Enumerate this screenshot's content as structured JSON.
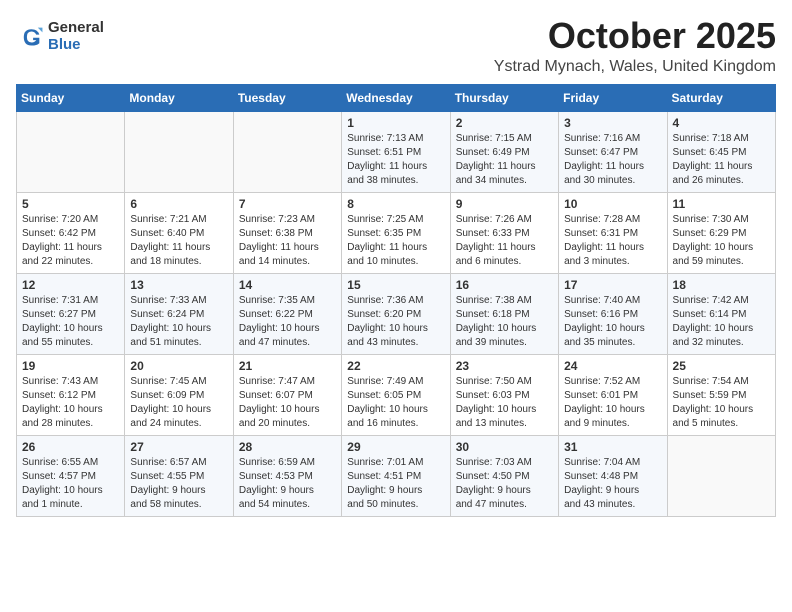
{
  "logo": {
    "general": "General",
    "blue": "Blue"
  },
  "title": "October 2025",
  "subtitle": "Ystrad Mynach, Wales, United Kingdom",
  "headers": [
    "Sunday",
    "Monday",
    "Tuesday",
    "Wednesday",
    "Thursday",
    "Friday",
    "Saturday"
  ],
  "weeks": [
    [
      {
        "day": "",
        "info": ""
      },
      {
        "day": "",
        "info": ""
      },
      {
        "day": "",
        "info": ""
      },
      {
        "day": "1",
        "info": "Sunrise: 7:13 AM\nSunset: 6:51 PM\nDaylight: 11 hours\nand 38 minutes."
      },
      {
        "day": "2",
        "info": "Sunrise: 7:15 AM\nSunset: 6:49 PM\nDaylight: 11 hours\nand 34 minutes."
      },
      {
        "day": "3",
        "info": "Sunrise: 7:16 AM\nSunset: 6:47 PM\nDaylight: 11 hours\nand 30 minutes."
      },
      {
        "day": "4",
        "info": "Sunrise: 7:18 AM\nSunset: 6:45 PM\nDaylight: 11 hours\nand 26 minutes."
      }
    ],
    [
      {
        "day": "5",
        "info": "Sunrise: 7:20 AM\nSunset: 6:42 PM\nDaylight: 11 hours\nand 22 minutes."
      },
      {
        "day": "6",
        "info": "Sunrise: 7:21 AM\nSunset: 6:40 PM\nDaylight: 11 hours\nand 18 minutes."
      },
      {
        "day": "7",
        "info": "Sunrise: 7:23 AM\nSunset: 6:38 PM\nDaylight: 11 hours\nand 14 minutes."
      },
      {
        "day": "8",
        "info": "Sunrise: 7:25 AM\nSunset: 6:35 PM\nDaylight: 11 hours\nand 10 minutes."
      },
      {
        "day": "9",
        "info": "Sunrise: 7:26 AM\nSunset: 6:33 PM\nDaylight: 11 hours\nand 6 minutes."
      },
      {
        "day": "10",
        "info": "Sunrise: 7:28 AM\nSunset: 6:31 PM\nDaylight: 11 hours\nand 3 minutes."
      },
      {
        "day": "11",
        "info": "Sunrise: 7:30 AM\nSunset: 6:29 PM\nDaylight: 10 hours\nand 59 minutes."
      }
    ],
    [
      {
        "day": "12",
        "info": "Sunrise: 7:31 AM\nSunset: 6:27 PM\nDaylight: 10 hours\nand 55 minutes."
      },
      {
        "day": "13",
        "info": "Sunrise: 7:33 AM\nSunset: 6:24 PM\nDaylight: 10 hours\nand 51 minutes."
      },
      {
        "day": "14",
        "info": "Sunrise: 7:35 AM\nSunset: 6:22 PM\nDaylight: 10 hours\nand 47 minutes."
      },
      {
        "day": "15",
        "info": "Sunrise: 7:36 AM\nSunset: 6:20 PM\nDaylight: 10 hours\nand 43 minutes."
      },
      {
        "day": "16",
        "info": "Sunrise: 7:38 AM\nSunset: 6:18 PM\nDaylight: 10 hours\nand 39 minutes."
      },
      {
        "day": "17",
        "info": "Sunrise: 7:40 AM\nSunset: 6:16 PM\nDaylight: 10 hours\nand 35 minutes."
      },
      {
        "day": "18",
        "info": "Sunrise: 7:42 AM\nSunset: 6:14 PM\nDaylight: 10 hours\nand 32 minutes."
      }
    ],
    [
      {
        "day": "19",
        "info": "Sunrise: 7:43 AM\nSunset: 6:12 PM\nDaylight: 10 hours\nand 28 minutes."
      },
      {
        "day": "20",
        "info": "Sunrise: 7:45 AM\nSunset: 6:09 PM\nDaylight: 10 hours\nand 24 minutes."
      },
      {
        "day": "21",
        "info": "Sunrise: 7:47 AM\nSunset: 6:07 PM\nDaylight: 10 hours\nand 20 minutes."
      },
      {
        "day": "22",
        "info": "Sunrise: 7:49 AM\nSunset: 6:05 PM\nDaylight: 10 hours\nand 16 minutes."
      },
      {
        "day": "23",
        "info": "Sunrise: 7:50 AM\nSunset: 6:03 PM\nDaylight: 10 hours\nand 13 minutes."
      },
      {
        "day": "24",
        "info": "Sunrise: 7:52 AM\nSunset: 6:01 PM\nDaylight: 10 hours\nand 9 minutes."
      },
      {
        "day": "25",
        "info": "Sunrise: 7:54 AM\nSunset: 5:59 PM\nDaylight: 10 hours\nand 5 minutes."
      }
    ],
    [
      {
        "day": "26",
        "info": "Sunrise: 6:55 AM\nSunset: 4:57 PM\nDaylight: 10 hours\nand 1 minute."
      },
      {
        "day": "27",
        "info": "Sunrise: 6:57 AM\nSunset: 4:55 PM\nDaylight: 9 hours\nand 58 minutes."
      },
      {
        "day": "28",
        "info": "Sunrise: 6:59 AM\nSunset: 4:53 PM\nDaylight: 9 hours\nand 54 minutes."
      },
      {
        "day": "29",
        "info": "Sunrise: 7:01 AM\nSunset: 4:51 PM\nDaylight: 9 hours\nand 50 minutes."
      },
      {
        "day": "30",
        "info": "Sunrise: 7:03 AM\nSunset: 4:50 PM\nDaylight: 9 hours\nand 47 minutes."
      },
      {
        "day": "31",
        "info": "Sunrise: 7:04 AM\nSunset: 4:48 PM\nDaylight: 9 hours\nand 43 minutes."
      },
      {
        "day": "",
        "info": ""
      }
    ]
  ]
}
